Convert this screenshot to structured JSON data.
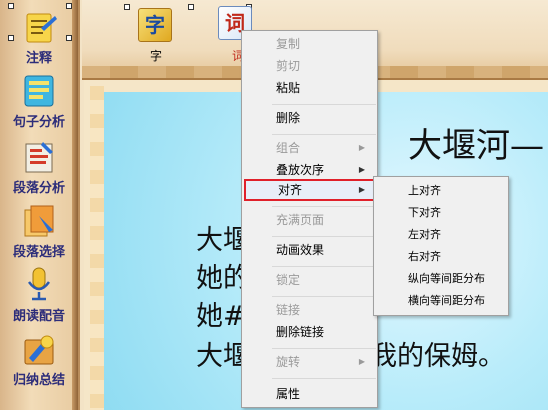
{
  "sidebar": {
    "items": [
      {
        "label": "注释",
        "icon": "annotation-icon"
      },
      {
        "label": "句子分析",
        "icon": "sentence-analysis-icon"
      },
      {
        "label": "段落分析",
        "icon": "paragraph-analysis-icon"
      },
      {
        "label": "段落选择",
        "icon": "paragraph-select-icon"
      },
      {
        "label": "朗读配音",
        "icon": "microphone-icon"
      },
      {
        "label": "归纳总结",
        "icon": "summary-icon"
      }
    ]
  },
  "toolbar": {
    "items": [
      {
        "glyph": "字",
        "label": "字"
      },
      {
        "glyph": "词",
        "label": "词"
      }
    ]
  },
  "slide": {
    "title": "大堰河—",
    "lines": [
      "大堰",
      "她的",
      "她#",
      "大堰"
    ],
    "tail": "我的保姆。"
  },
  "context_menu": {
    "items": [
      {
        "label": "复制",
        "disabled": true
      },
      {
        "label": "剪切",
        "disabled": true
      },
      {
        "label": "粘贴",
        "disabled": false
      },
      {
        "label": "删除",
        "disabled": false
      },
      {
        "label": "组合",
        "disabled": true,
        "submenu": true
      },
      {
        "label": "叠放次序",
        "disabled": false,
        "submenu": true
      },
      {
        "label": "对齐",
        "disabled": false,
        "submenu": true,
        "highlighted": true
      },
      {
        "label": "充满页面",
        "disabled": true
      },
      {
        "label": "动画效果",
        "disabled": false
      },
      {
        "label": "锁定",
        "disabled": true
      },
      {
        "label": "链接",
        "disabled": true
      },
      {
        "label": "删除链接",
        "disabled": false
      },
      {
        "label": "旋转",
        "disabled": true,
        "submenu": true
      },
      {
        "label": "属性",
        "disabled": false
      }
    ]
  },
  "align_submenu": {
    "items": [
      "上对齐",
      "下对齐",
      "左对齐",
      "右对齐",
      "纵向等间距分布",
      "横向等间距分布"
    ]
  },
  "colors": {
    "sidebar_label": "#2d2d7a",
    "highlight_border": "#e0202a",
    "slide_bg": "#b9ecfa"
  }
}
